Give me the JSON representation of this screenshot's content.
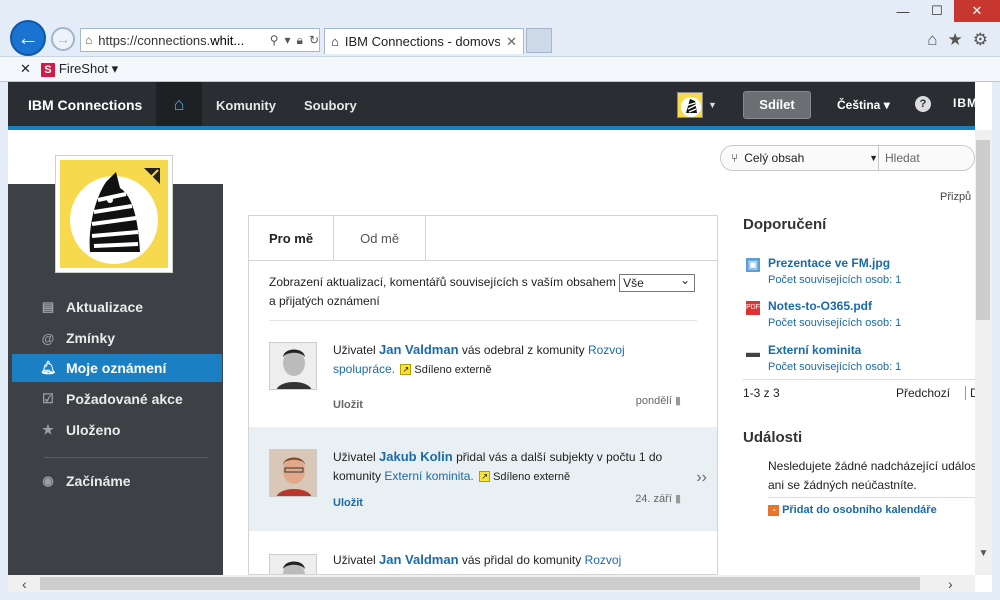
{
  "browser": {
    "url_prefix": "https://connections.",
    "url_host": "whit...",
    "tab_title": "IBM Connections - domovs...",
    "fireshot_label": "FireShot"
  },
  "header": {
    "brand": "IBM Connections",
    "nav": [
      "Komunity",
      "Soubory"
    ],
    "share_label": "Sdílet",
    "language": "Čeština",
    "help": "?",
    "ibm_logo": "IBM"
  },
  "search": {
    "scope_label": "Celý obsah",
    "placeholder": "Hledat"
  },
  "customize_label": "Přizpů",
  "sidebar": {
    "items": [
      {
        "label": "Aktualizace",
        "icon": "updates-icon"
      },
      {
        "label": "Zmínky",
        "icon": "at-icon"
      },
      {
        "label": "Moje oznámení",
        "icon": "bell-icon"
      },
      {
        "label": "Požadované akce",
        "icon": "clipboard-icon"
      },
      {
        "label": "Uloženo",
        "icon": "star-icon"
      }
    ],
    "getting_started": "Začínáme"
  },
  "main": {
    "tabs": [
      "Pro mě",
      "Od mě"
    ],
    "filter_text_1": "Zobrazení aktualizací, komentářů souvisejících s vaším obsahem",
    "filter_value": "Vše",
    "filter_text_2": "a přijatých oznámení",
    "entries": [
      {
        "prefix": "Uživatel",
        "actor": "Jan Valdman",
        "action": "vás odebral z komunity",
        "target_1": "Rozvoj",
        "target_2": "spolupráce.",
        "shared": "Sdíleno externě",
        "save": "Uložit",
        "date": "pondělí"
      },
      {
        "prefix": "Uživatel",
        "actor": "Jakub Kolin",
        "action": "přidal vás a další subjekty v počtu 1 do",
        "action_2": "komunity",
        "target_1": "Externí kominita.",
        "shared": "Sdíleno externě",
        "save": "Uložit",
        "date": "24. září"
      },
      {
        "prefix": "Uživatel",
        "actor": "Jan Valdman",
        "action": "vás přidal do komunity",
        "target_1": "Rozvoj"
      }
    ]
  },
  "recommendations": {
    "title": "Doporučení",
    "items": [
      {
        "title": "Prezentace ve FM.jpg",
        "sub": "Počet souvisejících osob: 1",
        "icon": "image-file-icon"
      },
      {
        "title": "Notes-to-O365.pdf",
        "sub": "Počet souvisejících osob: 1",
        "icon": "pdf-file-icon"
      },
      {
        "title": "Externí kominita",
        "sub": "Počet souvisejících osob: 1",
        "icon": "community-icon"
      }
    ],
    "count": "1-3 z 3",
    "prev": "Předchozí",
    "next": "D"
  },
  "events": {
    "title": "Události",
    "text_1": "Nesledujete žádné nadcházející událos",
    "text_2": "ani se žádných neúčastníte.",
    "add_link": "Přidat do osobního kalendáře"
  },
  "colors": {
    "accent": "#1b7fc4",
    "header_bg": "#2a2d31",
    "sidebar_bg": "#3d4146",
    "link": "#1b6aa8"
  }
}
